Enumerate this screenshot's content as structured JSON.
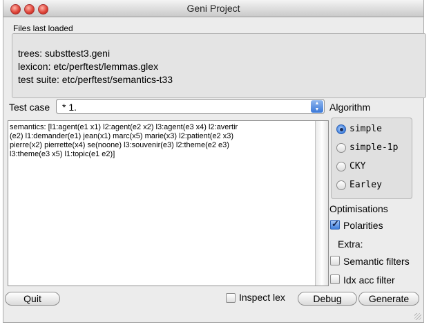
{
  "window": {
    "title": "Geni Project"
  },
  "files": {
    "section_label": "Files last loaded",
    "lines": [
      "trees: substtest3.geni",
      "lexicon: etc/perftest/lemmas.glex",
      "test suite: etc/perftest/semantics-t33"
    ]
  },
  "test_case": {
    "label": "Test case",
    "value": "* 1."
  },
  "semantics_text": "semantics: [l1:agent(e1 x1) l2:agent(e2 x2) l3:agent(e3 x4) l2:avertir\n(e2) l1:demander(e1) jean(x1) marc(x5) marie(x3) l2:patient(e2 x3)\npierre(x2) pierrette(x4) se(noone) l3:souvenir(e3) l2:theme(e2 e3)\nl3:theme(e3 x5) l1:topic(e1 e2)]",
  "algorithm": {
    "label": "Algorithm",
    "selected": "simple",
    "options": [
      "simple",
      "simple-1p",
      "CKY",
      "Earley"
    ]
  },
  "optimisations": {
    "label": "Optimisations",
    "polarities_label": "Polarities",
    "polarities_checked": true,
    "extra_label": "Extra:",
    "semantic_filters_label": "Semantic filters",
    "semantic_filters_checked": false,
    "idx_acc_filter_label": "Idx acc filter",
    "idx_acc_filter_checked": false
  },
  "bottom": {
    "quit_label": "Quit",
    "inspect_lex_label": "Inspect lex",
    "inspect_lex_checked": false,
    "debug_label": "Debug",
    "generate_label": "Generate"
  },
  "colors": {
    "traffic_light_red": "#e0473b",
    "accent_blue": "#3d7fe0"
  }
}
